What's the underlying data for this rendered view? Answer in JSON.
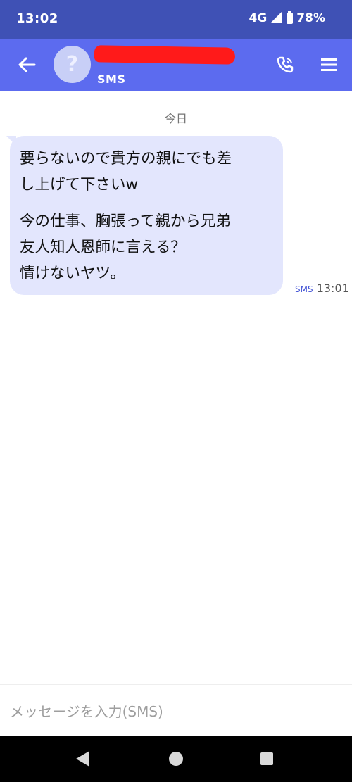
{
  "status_bar": {
    "time": "13:02",
    "network": "4G",
    "battery": "78%"
  },
  "toolbar": {
    "contact_name": "",
    "avatar_glyph": "?",
    "subtitle": "SMS",
    "icons": [
      "back-arrow-icon",
      "phone-call-icon",
      "menu-icon"
    ]
  },
  "conversation": {
    "date_separator": "今日",
    "messages": [
      {
        "direction": "incoming",
        "paragraphs": [
          "要らないので貴方の親にでも差\nし上げて下さいw",
          "今の仕事、胸張って親から兄弟\n友人知人恩師に言える？\n情けないヤツ。"
        ],
        "protocol": "SMS",
        "time": "13:01"
      }
    ]
  },
  "compose": {
    "placeholder": "メッセージを入力(SMS)",
    "value": ""
  },
  "colors": {
    "status_bar": "#3f51b5",
    "toolbar": "#5c6bef",
    "bubble": "#e3e6fd",
    "redaction": "#ff1a1a"
  }
}
